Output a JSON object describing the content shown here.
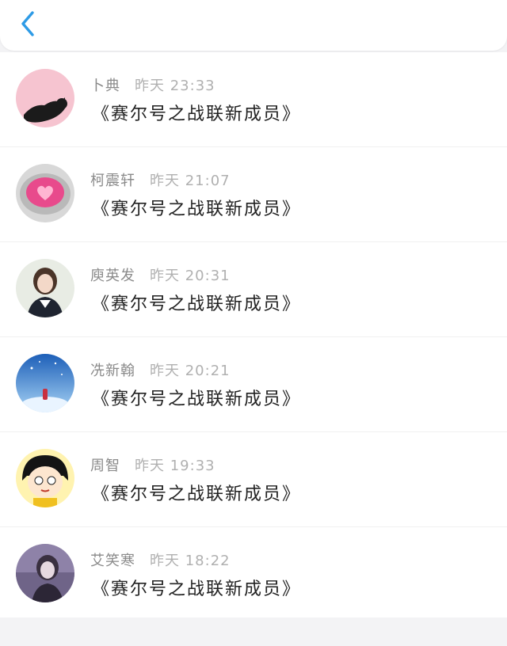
{
  "header": {
    "back_icon": "chevron-left-icon",
    "accent": "#2e9be6"
  },
  "messages": [
    {
      "name": "卜典",
      "time": "昨天 23:33",
      "text": "《赛尔号之战联新成员》",
      "avatar": "black-cat-avatar"
    },
    {
      "name": "柯震轩",
      "time": "昨天 21:07",
      "text": "《赛尔号之战联新成员》",
      "avatar": "pink-heart-cup-avatar"
    },
    {
      "name": "庾英发",
      "time": "昨天 20:31",
      "text": "《赛尔号之战联新成员》",
      "avatar": "girl-photo-avatar"
    },
    {
      "name": "冼新翰",
      "time": "昨天 20:21",
      "text": "《赛尔号之战联新成员》",
      "avatar": "blue-sky-avatar"
    },
    {
      "name": "周智",
      "time": "昨天 19:33",
      "text": "《赛尔号之战联新成员》",
      "avatar": "cartoon-girl-avatar"
    },
    {
      "name": "艾笑寒",
      "time": "昨天 18:22",
      "text": "《赛尔号之战联新成员》",
      "avatar": "purple-photo-avatar"
    }
  ]
}
